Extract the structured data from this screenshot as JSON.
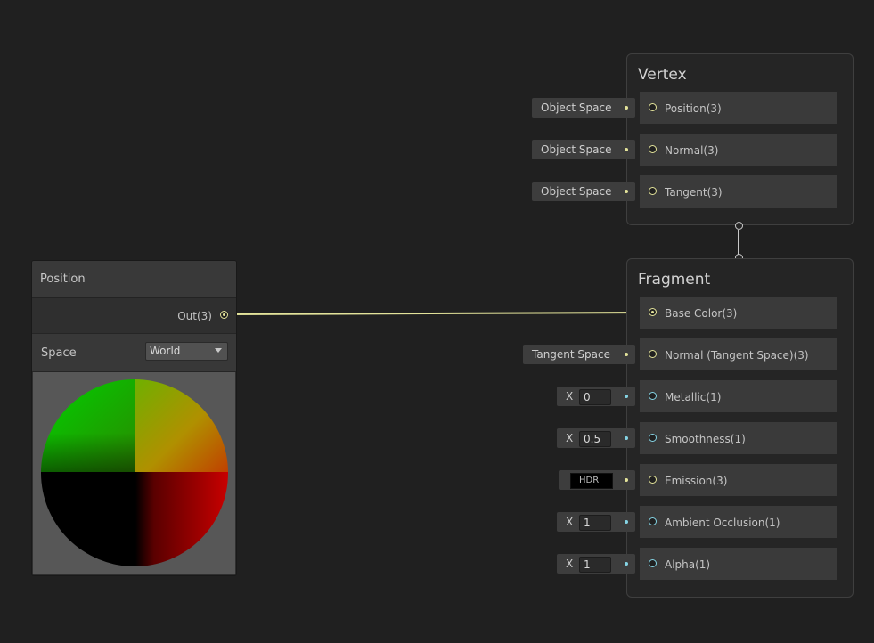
{
  "position_node": {
    "title": "Position",
    "output_label": "Out(3)",
    "space_label": "Space",
    "space_value": "World"
  },
  "vertex": {
    "title": "Vertex",
    "slots": [
      {
        "label": "Position(3)",
        "input": "Object Space"
      },
      {
        "label": "Normal(3)",
        "input": "Object Space"
      },
      {
        "label": "Tangent(3)",
        "input": "Object Space"
      }
    ]
  },
  "fragment": {
    "title": "Fragment",
    "slots": [
      {
        "label": "Base Color(3)"
      },
      {
        "label": "Normal (Tangent Space)(3)",
        "input": "Tangent Space"
      },
      {
        "label": "Metallic(1)",
        "axis": "X",
        "value": "0"
      },
      {
        "label": "Smoothness(1)",
        "axis": "X",
        "value": "0.5"
      },
      {
        "label": "Emission(3)",
        "input": "HDR"
      },
      {
        "label": "Ambient Occlusion(1)",
        "axis": "X",
        "value": "1"
      },
      {
        "label": "Alpha(1)",
        "axis": "X",
        "value": "1"
      }
    ]
  },
  "colors": {
    "vector3_port": "#e3e39a",
    "vector1_port": "#85d4e4",
    "edge": "#e3e39a"
  },
  "icons": {
    "dropdown": "chevron-down-icon",
    "port": "port-circle-icon"
  }
}
